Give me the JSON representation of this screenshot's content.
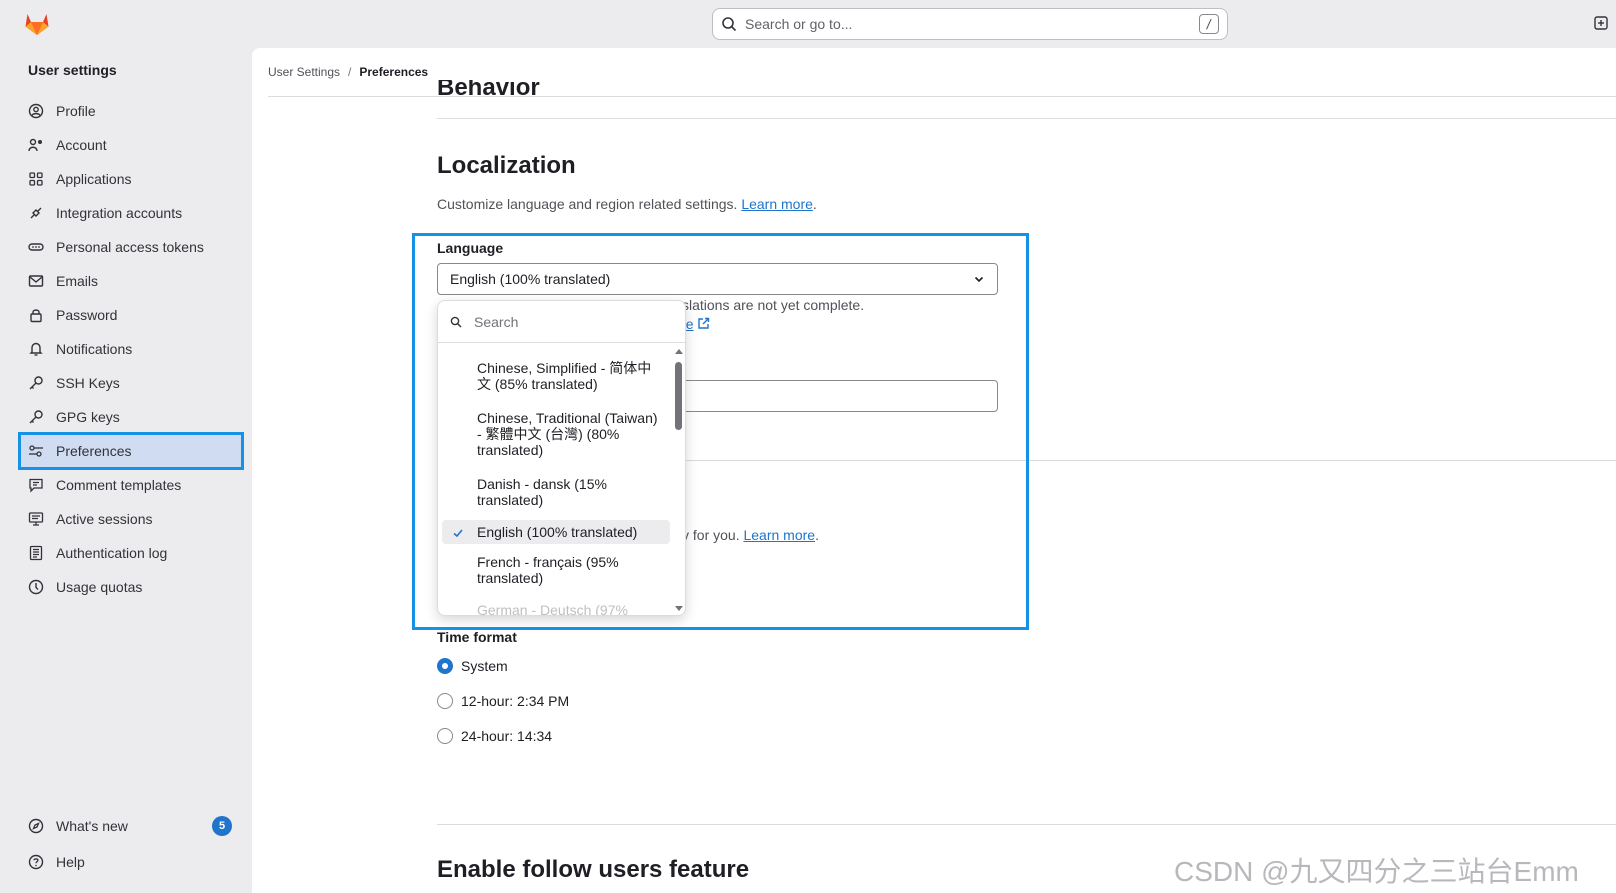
{
  "topbar": {
    "search_placeholder": "Search or go to...",
    "search_shortcut": "/"
  },
  "sidebar": {
    "title": "User settings",
    "items": [
      {
        "label": "Profile",
        "icon": "profile-icon"
      },
      {
        "label": "Account",
        "icon": "account-icon"
      },
      {
        "label": "Applications",
        "icon": "applications-icon"
      },
      {
        "label": "Integration accounts",
        "icon": "integration-icon"
      },
      {
        "label": "Personal access tokens",
        "icon": "token-icon"
      },
      {
        "label": "Emails",
        "icon": "mail-icon"
      },
      {
        "label": "Password",
        "icon": "lock-icon"
      },
      {
        "label": "Notifications",
        "icon": "bell-icon"
      },
      {
        "label": "SSH Keys",
        "icon": "key-icon"
      },
      {
        "label": "GPG keys",
        "icon": "key-icon"
      },
      {
        "label": "Preferences",
        "icon": "preferences-icon",
        "active": true
      },
      {
        "label": "Comment templates",
        "icon": "comment-icon"
      },
      {
        "label": "Active sessions",
        "icon": "monitor-icon"
      },
      {
        "label": "Authentication log",
        "icon": "log-icon"
      },
      {
        "label": "Usage quotas",
        "icon": "quota-icon"
      }
    ],
    "bottom": {
      "whats_new": "What's new",
      "whats_new_count": "5",
      "help": "Help"
    }
  },
  "breadcrumb": {
    "root": "User Settings",
    "separator": "/",
    "current": "Preferences"
  },
  "main": {
    "behavior_heading": "Behavior",
    "localization": {
      "title": "Localization",
      "description": "Customize language and region related settings.",
      "learn_more": "Learn more",
      "period": "."
    },
    "language": {
      "label": "Language",
      "selected": "English (100% translated)",
      "help_text_visible": "slations are not yet complete.",
      "help_link_visible": "ge"
    },
    "partial_text": "y for you.",
    "partial_link": "Learn more",
    "dropdown": {
      "search_placeholder": "Search",
      "options": [
        {
          "label": "Chinese, Simplified - 简体中文 (85% translated)",
          "selected": false
        },
        {
          "label": "Chinese, Traditional (Taiwan) - 繁體中文 (台灣) (80% translated)",
          "selected": false
        },
        {
          "label": "Danish - dansk (15% translated)",
          "selected": false
        },
        {
          "label": "English (100% translated)",
          "selected": true
        },
        {
          "label": "French - français (95% translated)",
          "selected": false
        },
        {
          "label": "German - Deutsch (97%",
          "selected": false
        }
      ]
    },
    "time_format": {
      "label": "Time format",
      "options": [
        {
          "label": "System",
          "checked": true
        },
        {
          "label": "12-hour: 2:34 PM",
          "checked": false
        },
        {
          "label": "24-hour: 14:34",
          "checked": false
        }
      ]
    },
    "follow_users_title": "Enable follow users feature"
  },
  "watermark": "CSDN @九又四分之三站台Emm",
  "colors": {
    "accent": "#1f75cb",
    "highlight": "#1592e6",
    "sidebar_bg": "#ececef",
    "active_item_bg": "#cfdcf1"
  }
}
